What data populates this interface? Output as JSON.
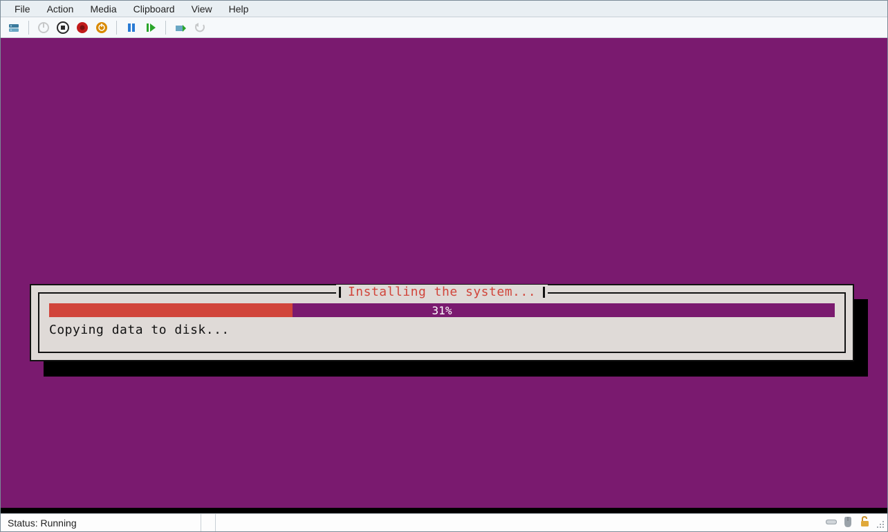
{
  "menubar": {
    "items": [
      "File",
      "Action",
      "Media",
      "Clipboard",
      "View",
      "Help"
    ]
  },
  "toolbar": {
    "icons": [
      {
        "name": "server-icon",
        "color": "#3a7a9c",
        "enabled": true
      },
      {
        "name": "power-icon",
        "color": "#8d8d8d",
        "enabled": false
      },
      {
        "name": "stop-icon",
        "color": "#2a2a2a",
        "enabled": true
      },
      {
        "name": "record-icon",
        "color": "#c11b1b",
        "enabled": true
      },
      {
        "name": "reset-icon",
        "color": "#d98a00",
        "enabled": true
      },
      {
        "name": "pause-icon",
        "color": "#2a7bd4",
        "enabled": true
      },
      {
        "name": "play-icon",
        "color": "#2aa52a",
        "enabled": true
      },
      {
        "name": "checkpoint-icon",
        "color": "#2aa52a",
        "enabled": true
      },
      {
        "name": "revert-icon",
        "color": "#8d8d8d",
        "enabled": false
      }
    ]
  },
  "installer": {
    "title": "Installing the system...",
    "progress_percent": 31,
    "progress_label": "31%",
    "message": "Copying data to disk..."
  },
  "statusbar": {
    "label": "Status: Running"
  },
  "colors": {
    "vm_bg": "#7a1a6f",
    "accent": "#d1453b"
  }
}
